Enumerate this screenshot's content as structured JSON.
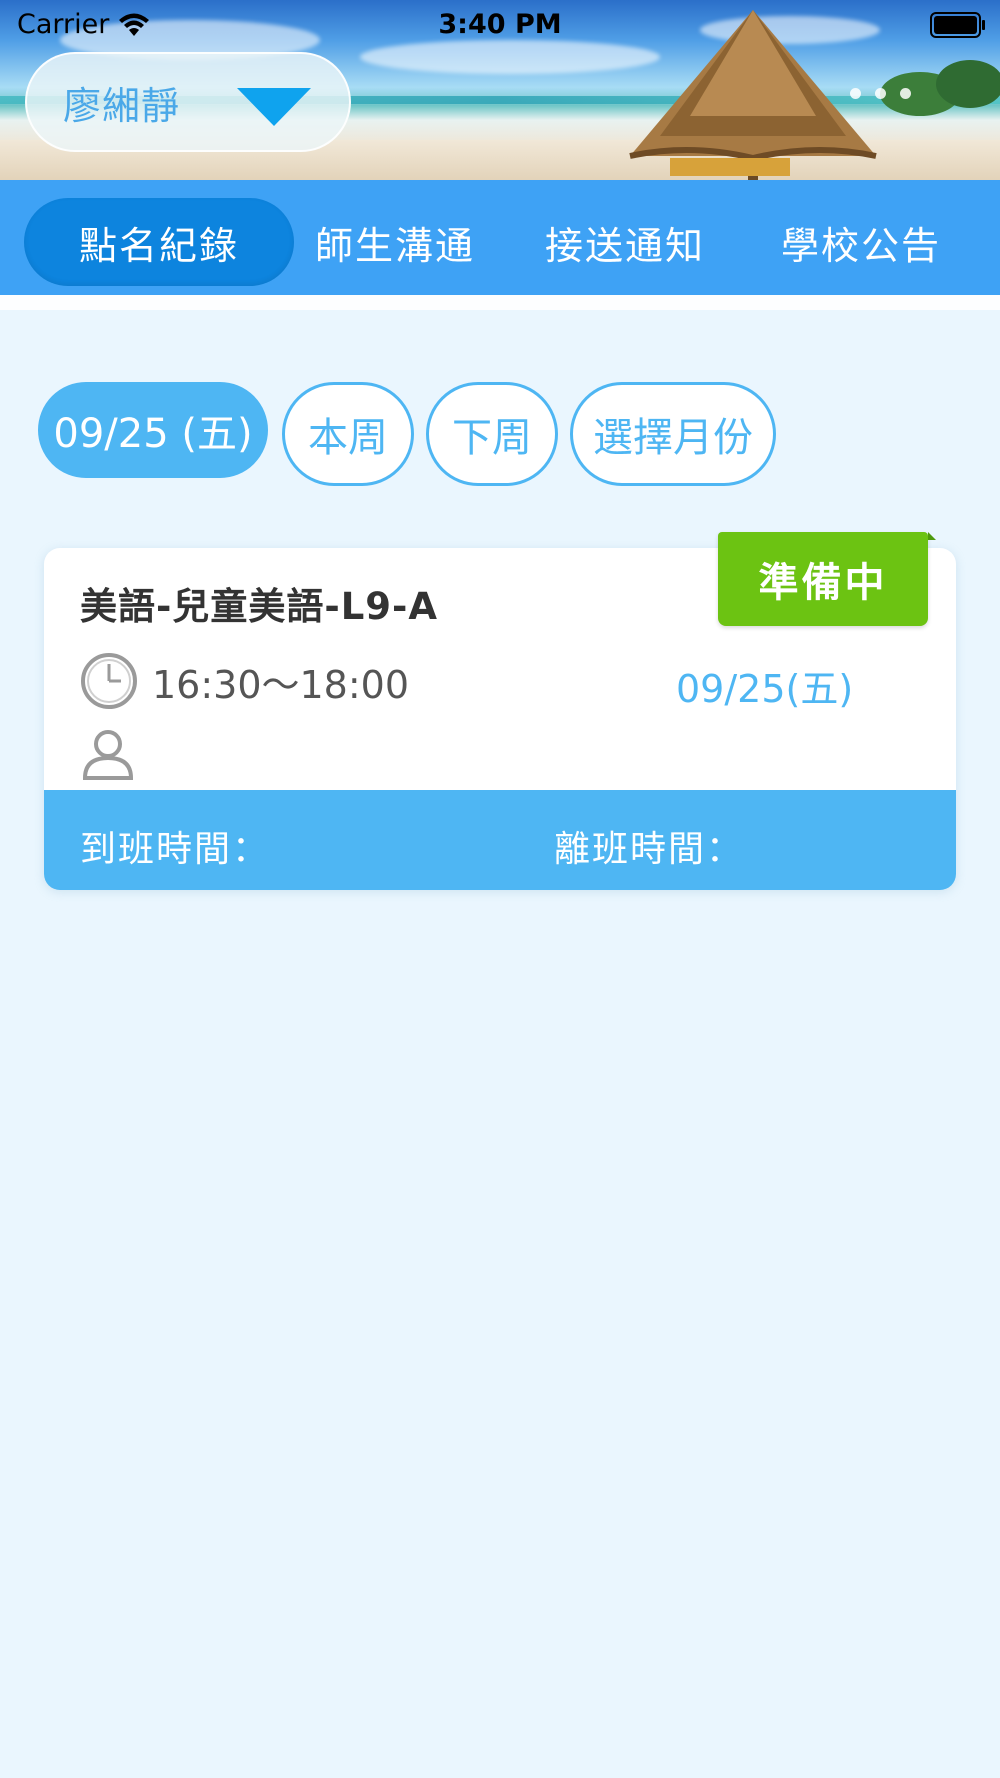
{
  "status_bar": {
    "carrier": "Carrier",
    "time": "3:40 PM"
  },
  "student_selector": {
    "name": "廖緗靜"
  },
  "tabs": [
    {
      "label": "點名紀錄",
      "active": true
    },
    {
      "label": "師生溝通",
      "active": false
    },
    {
      "label": "接送通知",
      "active": false
    },
    {
      "label": "學校公告",
      "active": false
    }
  ],
  "filters": [
    {
      "label": "09/25 (五)",
      "active": true
    },
    {
      "label": "本周",
      "active": false
    },
    {
      "label": "下周",
      "active": false
    },
    {
      "label": "選擇月份",
      "active": false
    }
  ],
  "class_card": {
    "title": "美語-兒童美語-L9-A",
    "time": "16:30～18:00",
    "date": "09/25(五)",
    "status": "準備中",
    "arrive_label": "到班時間：",
    "leave_label": "離班時間："
  },
  "colors": {
    "primary": "#3ea2f5",
    "active_tab": "#0d84de",
    "accent": "#4eb6f3",
    "status_green": "#6cc312",
    "page_bg": "#eaf6fe"
  },
  "icons": [
    "wifi-icon",
    "battery-icon",
    "chevron-down-icon",
    "clock-icon",
    "person-icon"
  ]
}
